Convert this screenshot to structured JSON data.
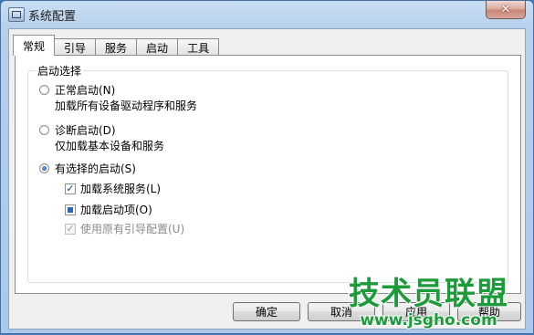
{
  "window": {
    "title": "系统配置",
    "close_icon": "close-icon"
  },
  "tabs": [
    {
      "label": "常规",
      "active": true
    },
    {
      "label": "引导",
      "active": false
    },
    {
      "label": "服务",
      "active": false
    },
    {
      "label": "启动",
      "active": false
    },
    {
      "label": "工具",
      "active": false
    }
  ],
  "startup_group": {
    "label": "启动选择",
    "normal": {
      "label": "正常启动(N)",
      "desc": "加载所有设备驱动程序和服务",
      "checked": false
    },
    "diagnostic": {
      "label": "诊断启动(D)",
      "desc": "仅加载基本设备和服务",
      "checked": false
    },
    "selective": {
      "label": "有选择的启动(S)",
      "checked": true
    },
    "options": [
      {
        "label": "加载系统服务(L)",
        "state": "checked",
        "disabled": false
      },
      {
        "label": "加载启动项(O)",
        "state": "indeterminate",
        "disabled": false
      },
      {
        "label": "使用原有引导配置(U)",
        "state": "checked",
        "disabled": true
      }
    ]
  },
  "buttons": {
    "ok": "确定",
    "cancel": "取消",
    "apply": "应用",
    "help": "帮助"
  },
  "watermark": {
    "main": "技术员联盟",
    "url": "www.jsgho.com"
  }
}
